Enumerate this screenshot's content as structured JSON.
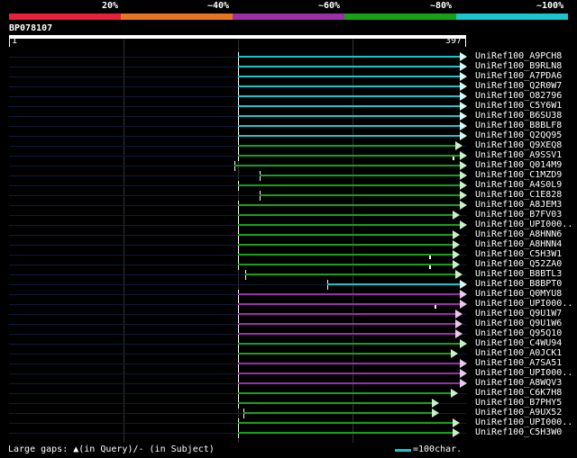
{
  "colorbar": {
    "segments": [
      {
        "label": "20%",
        "color": "#e8203a"
      },
      {
        "label": "~40%",
        "color": "#e97520"
      },
      {
        "label": "~60%",
        "color": "#9b2fa8"
      },
      {
        "label": "~80%",
        "color": "#17a118"
      },
      {
        "label": "~100%",
        "color": "#19c6cc"
      }
    ]
  },
  "query": {
    "name": "BP078107",
    "start_label": "1",
    "end_label": "397",
    "length": 397
  },
  "colors": {
    "cyan": "#19c6cc",
    "green": "#17a118",
    "magenta": "#9b2fa8",
    "unaligned": "#101a3a"
  },
  "hits": [
    {
      "name": "UniRef100_A9PCH8",
      "color": "cyan",
      "start": 199,
      "end": 397,
      "full": true,
      "marks": []
    },
    {
      "name": "UniRef100_B9RLN8",
      "color": "cyan",
      "start": 199,
      "end": 397,
      "full": true,
      "marks": []
    },
    {
      "name": "UniRef100_A7PDA6",
      "color": "cyan",
      "start": 199,
      "end": 397,
      "full": true,
      "marks": []
    },
    {
      "name": "UniRef100_Q2R0W7",
      "color": "cyan",
      "start": 199,
      "end": 397,
      "full": true,
      "marks": []
    },
    {
      "name": "UniRef100_O82796",
      "color": "cyan",
      "start": 199,
      "end": 397,
      "full": true,
      "marks": []
    },
    {
      "name": "UniRef100_C5Y6W1",
      "color": "cyan",
      "start": 199,
      "end": 397,
      "full": true,
      "marks": []
    },
    {
      "name": "UniRef100_B6SU38",
      "color": "cyan",
      "start": 199,
      "end": 397,
      "full": true,
      "marks": []
    },
    {
      "name": "UniRef100_B8BLF8",
      "color": "cyan",
      "start": 199,
      "end": 397,
      "full": true,
      "marks": []
    },
    {
      "name": "UniRef100_Q2QQ95",
      "color": "cyan",
      "start": 199,
      "end": 397,
      "full": true,
      "marks": []
    },
    {
      "name": "UniRef100_Q9XEQ8",
      "color": "green",
      "start": 199,
      "end": 393,
      "full": true,
      "marks": []
    },
    {
      "name": "UniRef100_A9SSV1",
      "color": "green",
      "start": 199,
      "end": 397,
      "full": true,
      "marks": [
        385
      ]
    },
    {
      "name": "UniRef100_Q014M9",
      "color": "green",
      "start": 196,
      "end": 397,
      "full": true,
      "marks": []
    },
    {
      "name": "UniRef100_C1MZD9",
      "color": "green",
      "start": 218,
      "end": 397,
      "full": true,
      "marks": []
    },
    {
      "name": "UniRef100_A4S0L9",
      "color": "green",
      "start": 199,
      "end": 397,
      "full": true,
      "marks": []
    },
    {
      "name": "UniRef100_C1E828",
      "color": "green",
      "start": 218,
      "end": 397,
      "full": true,
      "marks": []
    },
    {
      "name": "UniRef100_A8JEM3",
      "color": "green",
      "start": 199,
      "end": 397,
      "full": true,
      "marks": []
    },
    {
      "name": "UniRef100_B7FV03",
      "color": "green",
      "start": 199,
      "end": 391,
      "full": true,
      "marks": []
    },
    {
      "name": "UniRef100_UPI000..",
      "color": "green",
      "start": 199,
      "end": 397,
      "full": true,
      "marks": []
    },
    {
      "name": "UniRef100_A8HNN6",
      "color": "green",
      "start": 199,
      "end": 391,
      "full": true,
      "marks": []
    },
    {
      "name": "UniRef100_A8HNN4",
      "color": "green",
      "start": 199,
      "end": 391,
      "full": true,
      "marks": []
    },
    {
      "name": "UniRef100_C5H3W1",
      "color": "green",
      "start": 199,
      "end": 391,
      "full": true,
      "marks": [
        365
      ]
    },
    {
      "name": "UniRef100_Q52ZA0",
      "color": "green",
      "start": 199,
      "end": 391,
      "full": true,
      "marks": [
        365
      ]
    },
    {
      "name": "UniRef100_B8BTL3",
      "color": "green",
      "start": 206,
      "end": 393,
      "full": true,
      "marks": []
    },
    {
      "name": "UniRef100_B8BPT0",
      "color": "cyan",
      "start": 277,
      "end": 397,
      "full": true,
      "marks": []
    },
    {
      "name": "UniRef100_Q0MYU8",
      "color": "magenta",
      "start": 199,
      "end": 397,
      "full": true,
      "marks": []
    },
    {
      "name": "UniRef100_UPI000..",
      "color": "magenta",
      "start": 199,
      "end": 397,
      "full": true,
      "marks": [
        370
      ]
    },
    {
      "name": "UniRef100_Q9U1W7",
      "color": "magenta",
      "start": 199,
      "end": 393,
      "full": true,
      "marks": []
    },
    {
      "name": "UniRef100_Q9U1W6",
      "color": "magenta",
      "start": 199,
      "end": 393,
      "full": true,
      "marks": []
    },
    {
      "name": "UniRef100_Q95Q10",
      "color": "magenta",
      "start": 199,
      "end": 393,
      "full": true,
      "marks": []
    },
    {
      "name": "UniRef100_C4WU94",
      "color": "green",
      "start": 199,
      "end": 397,
      "full": true,
      "marks": []
    },
    {
      "name": "UniRef100_A0JCK1",
      "color": "green",
      "start": 199,
      "end": 389,
      "full": true,
      "marks": []
    },
    {
      "name": "UniRef100_A7SA51",
      "color": "magenta",
      "start": 199,
      "end": 397,
      "full": true,
      "marks": []
    },
    {
      "name": "UniRef100_UPI000..",
      "color": "magenta",
      "start": 199,
      "end": 397,
      "full": true,
      "marks": []
    },
    {
      "name": "UniRef100_A8WQV3",
      "color": "magenta",
      "start": 199,
      "end": 397,
      "full": true,
      "marks": []
    },
    {
      "name": "UniRef100_C6K7H8",
      "color": "green",
      "start": 199,
      "end": 389,
      "full": true,
      "marks": []
    },
    {
      "name": "UniRef100_B7PHY5",
      "color": "green",
      "start": 199,
      "end": 373,
      "full": true,
      "marks": []
    },
    {
      "name": "UniRef100_A9UX52",
      "color": "green",
      "start": 204,
      "end": 373,
      "full": true,
      "marks": []
    },
    {
      "name": "UniRef100_UPI000..",
      "color": "green",
      "start": 199,
      "end": 391,
      "full": true,
      "marks": []
    },
    {
      "name": "UniRef100_C5H3W0",
      "color": "green",
      "start": 199,
      "end": 391,
      "full": true,
      "marks": []
    }
  ],
  "footer": {
    "gaps_text": "Large gaps: ▲(in Query)/- (in Subject)",
    "legend_text": "=100char."
  }
}
